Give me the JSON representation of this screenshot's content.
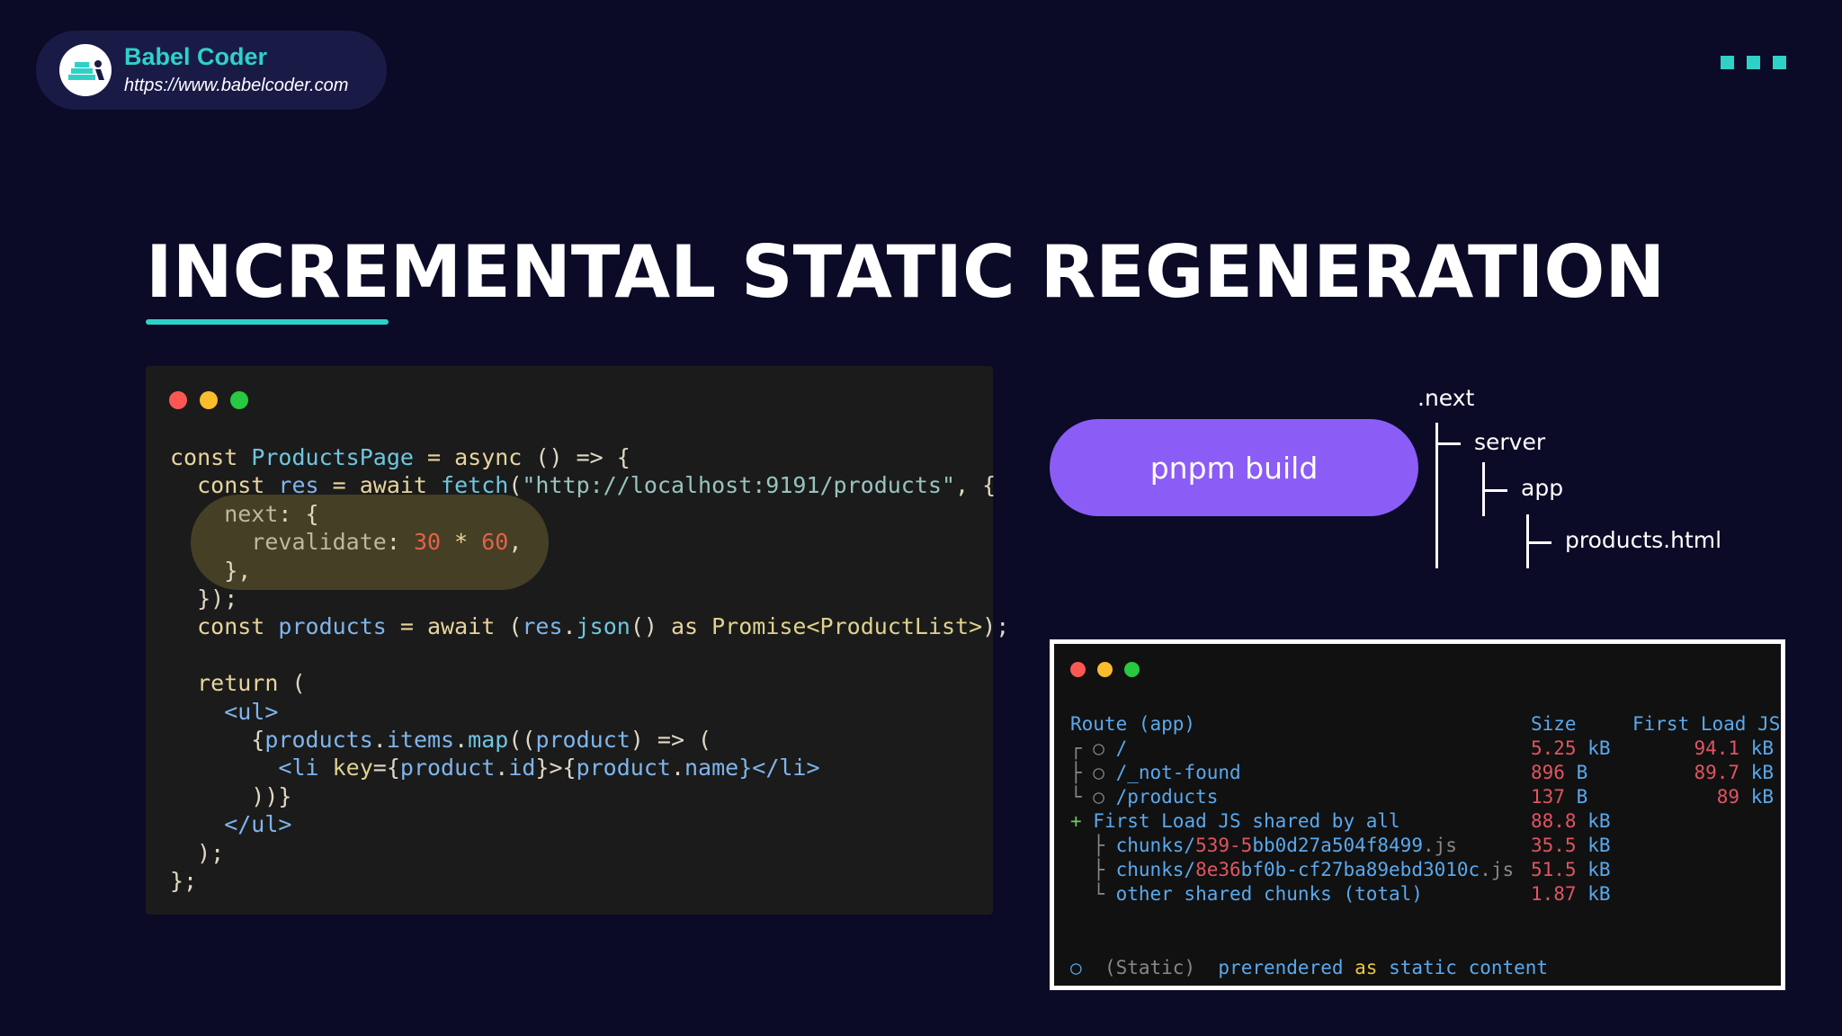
{
  "brand": {
    "name": "Babel Coder",
    "url": "https://www.babelcoder.com"
  },
  "slide": {
    "title": "INCREMENTAL STATIC REGENERATION"
  },
  "code": {
    "l1": {
      "a": "const ",
      "b": "ProductsPage",
      "c": " = ",
      "d": "async",
      "e": " () => {"
    },
    "l2": {
      "a": "  const ",
      "b": "res",
      "c": " = await ",
      "d": "fetch",
      "e": "(",
      "f": "\"http://localhost:9191/products\"",
      "g": ", {"
    },
    "l3": {
      "a": "    next",
      "b": ": {"
    },
    "l4": {
      "a": "      revalidate",
      "b": ": ",
      "c": "30",
      "d": " * ",
      "e": "60",
      "f": ","
    },
    "l5": "    },",
    "l6": "  });",
    "l7": {
      "a": "  const ",
      "b": "products",
      "c": " = await ",
      "d": "(",
      "e": "res",
      "f": ".",
      "g": "json",
      "h": "() ",
      "i": "as",
      "j": " Promise<ProductList>",
      "k": ");"
    },
    "l9": {
      "a": "  return",
      "b": " ("
    },
    "l10": "    <ul>",
    "l11": {
      "a": "      {",
      "b": "products",
      "c": ".",
      "d": "items",
      "e": ".",
      "f": "map",
      "g": "((",
      "h": "product",
      "i": ") => ("
    },
    "l12": {
      "a": "        <li ",
      "b": "key",
      "c": "={",
      "d": "product",
      "e": ".",
      "f": "id",
      "g": "}>{",
      "h": "product",
      "i": ".",
      "j": "name",
      "k": "}</li>"
    },
    "l13": "      ))}",
    "l14": "    </ul>",
    "l15": "  );",
    "l16": "};"
  },
  "build_button": "pnpm build",
  "tree": {
    "root": ".next",
    "server": "server",
    "app": "app",
    "file": "products.html"
  },
  "terminal": {
    "header": {
      "route": "Route (app)",
      "size": "Size",
      "first_load": "First Load JS"
    },
    "rows": [
      {
        "prefix": "┌ ○ ",
        "route": "/",
        "size_num": "5.25",
        "size_unit": " kB",
        "load_num": "94.1",
        "load_unit": " kB"
      },
      {
        "prefix": "├ ○ ",
        "route": "/_not-found",
        "size_num": "896",
        "size_unit": " B",
        "load_num": "89.7",
        "load_unit": " kB"
      },
      {
        "prefix": "└ ○ ",
        "route": "/products",
        "size_num": "137",
        "size_unit": " B",
        "load_num": "89",
        "load_unit": " kB"
      }
    ],
    "shared": {
      "prefix": "+ ",
      "label": "First Load JS shared by all",
      "size_num": "88.8",
      "size_unit": " kB"
    },
    "chunks": [
      {
        "prefix": "  ├ ",
        "dir": "chunks/",
        "hash_red": "539-5",
        "hash_rest": "bb0d27a504f8499",
        "ext": ".js",
        "size_num": "35.5",
        "size_unit": " kB"
      },
      {
        "prefix": "  ├ ",
        "dir": "chunks/",
        "hash_red": "8e36",
        "hash_rest": "bf0b-cf27ba89ebd3010c",
        "ext": ".js",
        "size_num": "51.5",
        "size_unit": " kB"
      },
      {
        "prefix": "  └ ",
        "dir": "other shared chunks ",
        "hash_red": "",
        "hash_rest": "(total)",
        "ext": "",
        "size_num": "1.87",
        "size_unit": " kB"
      }
    ],
    "legend": {
      "symbol": "○",
      "kind": "(Static)",
      "text_a": "prerendered ",
      "text_b": "as",
      "text_c": " static content"
    }
  }
}
